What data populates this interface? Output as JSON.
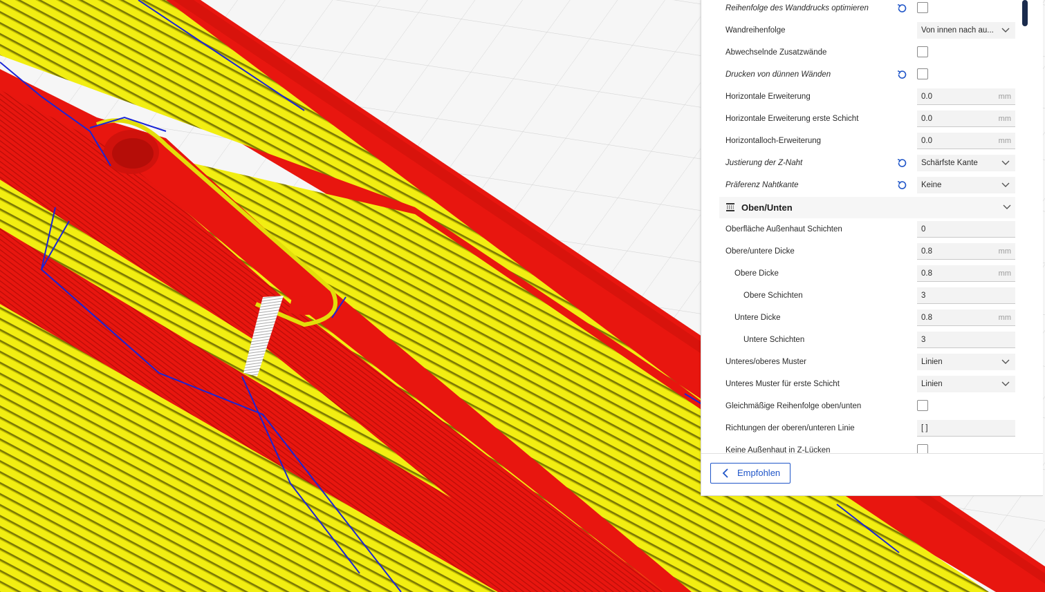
{
  "colors": {
    "accent": "#1f55c8",
    "wall": "#e8160f",
    "infill": "#f2ee12",
    "travel": "#1a25d6",
    "seam": "#ffffff"
  },
  "settings": {
    "rows_top": [
      {
        "label": "Reihenfolge des Wanddrucks optimieren",
        "italic": true,
        "reset": true,
        "control": "checkbox"
      },
      {
        "label": "Wandreihenfolge",
        "italic": false,
        "reset": false,
        "control": "select",
        "value": "Von innen nach au..."
      },
      {
        "label": "Abwechselnde Zusatzwände",
        "italic": false,
        "reset": false,
        "control": "checkbox"
      },
      {
        "label": "Drucken von dünnen Wänden",
        "italic": true,
        "reset": true,
        "control": "checkbox"
      },
      {
        "label": "Horizontale Erweiterung",
        "italic": false,
        "reset": false,
        "control": "field",
        "value": "0.0",
        "unit": "mm"
      },
      {
        "label": "Horizontale Erweiterung erste Schicht",
        "italic": false,
        "reset": false,
        "control": "field",
        "value": "0.0",
        "unit": "mm"
      },
      {
        "label": "Horizontalloch-Erweiterung",
        "italic": false,
        "reset": false,
        "control": "field",
        "value": "0.0",
        "unit": "mm"
      },
      {
        "label": "Justierung der Z-Naht",
        "italic": true,
        "reset": true,
        "control": "select",
        "value": "Schärfste Kante"
      },
      {
        "label": "Präferenz Nahtkante",
        "italic": true,
        "reset": true,
        "control": "select",
        "value": "Keine"
      }
    ],
    "section": {
      "title": "Oben/Unten",
      "icon": "top-bottom-icon"
    },
    "rows_bottom": [
      {
        "label": "Oberfläche Außenhaut Schichten",
        "indent": 0,
        "control": "field",
        "value": "0",
        "unit": ""
      },
      {
        "label": "Obere/untere Dicke",
        "indent": 0,
        "control": "field",
        "value": "0.8",
        "unit": "mm"
      },
      {
        "label": "Obere Dicke",
        "indent": 1,
        "control": "field",
        "value": "0.8",
        "unit": "mm"
      },
      {
        "label": "Obere Schichten",
        "indent": 2,
        "control": "field",
        "value": "3",
        "unit": ""
      },
      {
        "label": "Untere Dicke",
        "indent": 1,
        "control": "field",
        "value": "0.8",
        "unit": "mm"
      },
      {
        "label": "Untere Schichten",
        "indent": 2,
        "control": "field",
        "value": "3",
        "unit": ""
      },
      {
        "label": "Unteres/oberes Muster",
        "indent": 0,
        "control": "select",
        "value": "Linien"
      },
      {
        "label": "Unteres Muster für erste Schicht",
        "indent": 0,
        "control": "select",
        "value": "Linien"
      },
      {
        "label": "Gleichmäßige Reihenfolge oben/unten",
        "indent": 0,
        "control": "checkbox"
      },
      {
        "label": "Richtungen der oberen/unteren Linie",
        "indent": 0,
        "control": "field",
        "value": "[ ]",
        "unit": ""
      },
      {
        "label": "Keine Außenhaut in Z-Lücken",
        "indent": 0,
        "control": "checkbox"
      }
    ]
  },
  "footer": {
    "recommended_label": "Empfohlen",
    "recommended_icon": "chevron-left-icon"
  }
}
